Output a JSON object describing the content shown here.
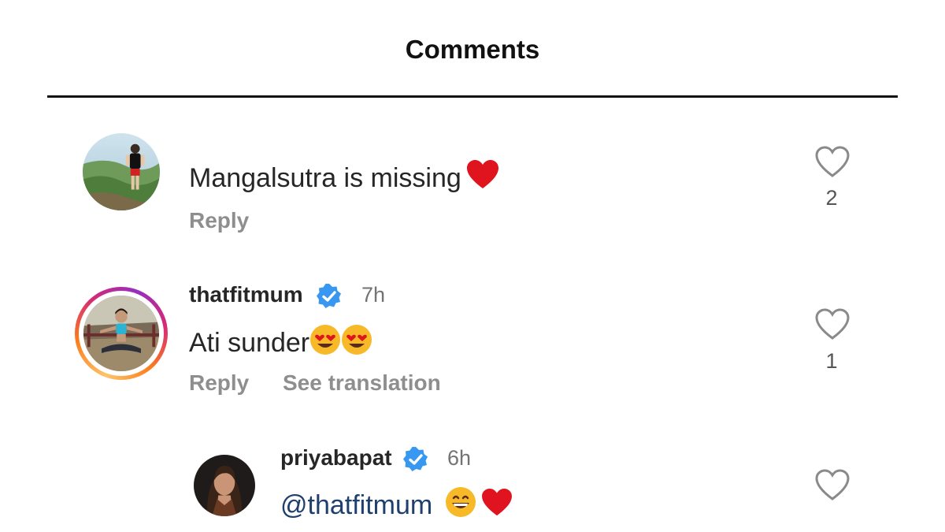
{
  "header": {
    "title": "Comments"
  },
  "comments": [
    {
      "username": "",
      "time": "",
      "text": "Mangalsutra is missing",
      "reply_label": "Reply",
      "likes": "2",
      "avatar": "person-standing-on-hill-avatar"
    },
    {
      "username": "thatfitmum",
      "verified": true,
      "time": "7h",
      "text": "Ati sunder",
      "reply_label": "Reply",
      "translate_label": "See translation",
      "likes": "1",
      "avatar": "woman-yoga-pose-avatar",
      "has_story_ring": true
    },
    {
      "username": "priyabapat",
      "verified": true,
      "time": "6h",
      "mention": "@thatfitmum",
      "likes": "",
      "avatar": "woman-portrait-avatar"
    }
  ],
  "icons": {
    "like": "heart-outline-icon",
    "verified": "verified-badge-icon"
  },
  "colors": {
    "verified_blue": "#3897f0",
    "heart_red": "#e0141e",
    "mention_blue": "#1f3f6e",
    "secondary_text": "#8e8e8e"
  }
}
